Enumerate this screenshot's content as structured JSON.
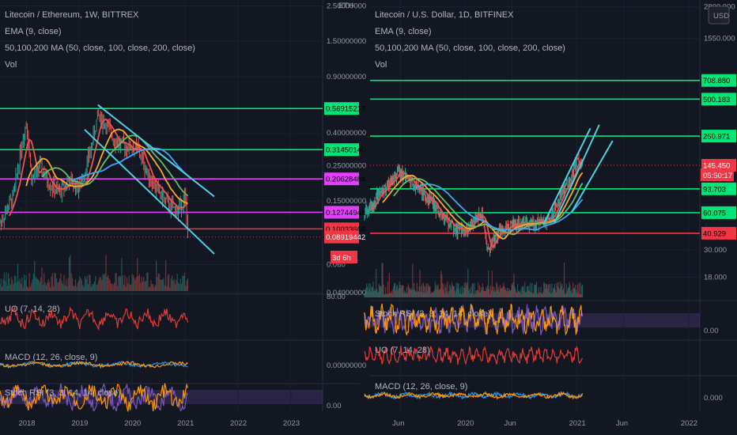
{
  "panels": {
    "left": {
      "title": "Litecoin / Ethereum, 1W, BITTREX",
      "indicators": [
        "EMA (9, close)",
        "50,100,200 MA (50, close, 100, close, 200, close)",
        "Vol"
      ],
      "sub": {
        "uo": "UO (7, 14, 28)",
        "macd": "MACD (12, 26, close, 9)",
        "stoch": "Stoch RSI (3, 3, 14, 14, close)"
      },
      "scale_label": "ETH"
    },
    "right": {
      "title": "Litecoin / U.S. Dollar, 1D, BITFINEX",
      "indicators": [
        "EMA (9, close)",
        "50,100,200 MA (50, close, 100, close, 200, close)",
        "Vol"
      ],
      "sub": {
        "stoch": "Stoch RSI (3, 3, 14, 14, close)",
        "uo": "UO (7, 14, 28)",
        "macd": "MACD (12, 26, close, 9)"
      },
      "scale_label": "USD"
    }
  },
  "colors": {
    "green": "#00e676",
    "magenta": "#e040fb",
    "red": "#f23645",
    "cyan": "#4dd0e1",
    "background": "#131722"
  },
  "chart_data": [
    {
      "type": "line",
      "title": "Litecoin / Ethereum, 1W, BITTREX",
      "log_scale": true,
      "x_ticks": [
        "2018",
        "2019",
        "2020",
        "2021",
        "2022",
        "2023"
      ],
      "y_ticks": [
        2.5,
        1.5,
        0.9,
        0.4,
        0.25,
        0.15,
        0.06,
        0.04
      ],
      "y_tick_labels": [
        "2.50000000",
        "1.50000000",
        "0.90000000",
        "0.40000000",
        "0.25000000",
        "0.15000000",
        "0.060",
        "0.04000000"
      ],
      "ylim": [
        0.04,
        2.6
      ],
      "horizontal_levels": [
        {
          "value": 0.56915217,
          "label": "0.56915217",
          "color": "#00e676"
        },
        {
          "value": 0.3145014,
          "label": "0.31450140",
          "color": "#00e676"
        },
        {
          "value": 0.20628484,
          "label": "0.20628484",
          "color": "#e040fb"
        },
        {
          "value": 0.12744948,
          "label": "0.12744948",
          "color": "#e040fb"
        },
        {
          "value": 0.10033666,
          "label": "0.10033666",
          "color": "#f23645"
        }
      ],
      "price_tags": [
        {
          "value": 0.08919442,
          "label": "0.08919442"
        }
      ],
      "countdown": "3d 6h",
      "sub_axis": {
        "uo": "80.00",
        "macd": "0.00000000",
        "stoch": "0.00"
      },
      "price_series": {
        "x": [
          2017.5,
          2017.75,
          2017.9,
          2018.0,
          2018.1,
          2018.25,
          2018.4,
          2018.6,
          2018.8,
          2019.0,
          2019.2,
          2019.35,
          2019.5,
          2019.7,
          2019.9,
          2020.1,
          2020.3,
          2020.5,
          2020.7,
          2020.85,
          2021.0,
          2021.05
        ],
        "y": [
          0.11,
          0.16,
          0.33,
          0.48,
          0.2,
          0.25,
          0.2,
          0.17,
          0.2,
          0.18,
          0.3,
          0.52,
          0.45,
          0.35,
          0.33,
          0.32,
          0.22,
          0.17,
          0.14,
          0.13,
          0.16,
          0.095
        ]
      }
    },
    {
      "type": "line",
      "title": "Litecoin / U.S. Dollar, 1D, BITFINEX",
      "log_scale": true,
      "x_ticks": [
        "Jun",
        "2020",
        "Jun",
        "2021",
        "Jun",
        "2022"
      ],
      "y_ticks": [
        2800,
        1550,
        30,
        18
      ],
      "y_tick_labels": [
        "2800.000",
        "1550.000",
        "30.000",
        "18.000"
      ],
      "ylim": [
        12,
        3000
      ],
      "horizontal_levels": [
        {
          "value": 708.88,
          "label": "708.880",
          "color": "#00e676"
        },
        {
          "value": 500.183,
          "label": "500.183",
          "color": "#00e676"
        },
        {
          "value": 250.971,
          "label": "250.971",
          "color": "#00e676"
        },
        {
          "value": 93.703,
          "label": "93.703",
          "color": "#00e676"
        },
        {
          "value": 60.075,
          "label": "60.075",
          "color": "#00e676"
        },
        {
          "value": 40.929,
          "label": "40.929",
          "color": "#f23645"
        }
      ],
      "price_tags": [
        {
          "value": 145.45,
          "label": "145.450"
        }
      ],
      "countdown": "05:50:17",
      "sub_axis": {
        "stoch": "0.00",
        "macd": "0.000"
      },
      "price_series": {
        "x": [
          2019.1,
          2019.25,
          2019.4,
          2019.5,
          2019.6,
          2019.75,
          2019.9,
          2020.0,
          2020.15,
          2020.2,
          2020.3,
          2020.45,
          2020.6,
          2020.75,
          2020.85,
          2020.95,
          2021.0,
          2021.05
        ],
        "y": [
          60,
          90,
          130,
          110,
          90,
          65,
          45,
          42,
          60,
          30,
          42,
          48,
          50,
          52,
          80,
          120,
          160,
          145
        ]
      }
    }
  ]
}
